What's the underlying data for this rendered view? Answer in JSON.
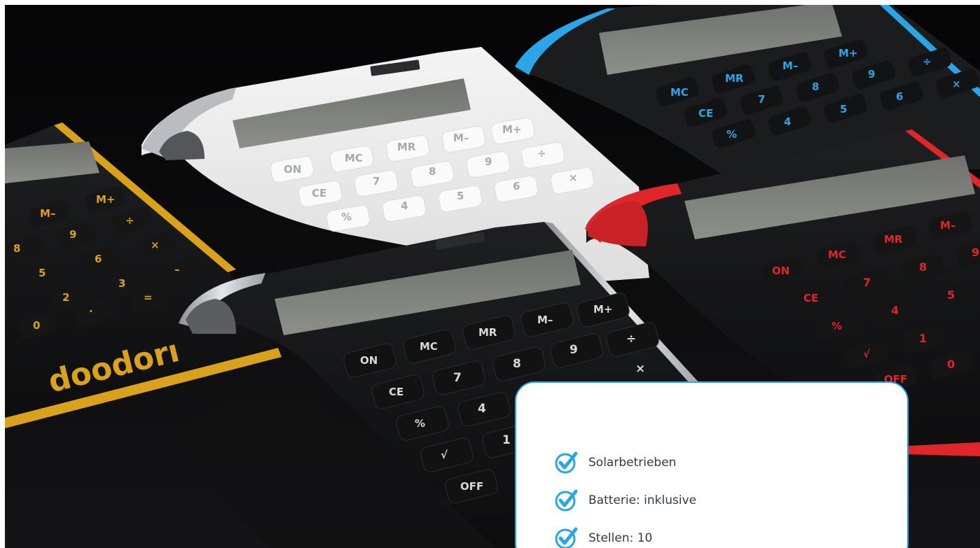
{
  "features": {
    "accent_color": "#2aa6e8",
    "icon": "checkmark-circle-icon",
    "items": [
      {
        "label": "Solarbetrieben"
      },
      {
        "label": "Batterie: inklusive"
      },
      {
        "label": "Stellen: 10"
      }
    ]
  },
  "photo": {
    "subject": "desk calculators",
    "colors": [
      "#d9a21a",
      "#e8e8e8",
      "#2aa6e8",
      "#e0262b",
      "#c9ccd0"
    ],
    "calculator_keys": {
      "memory_row": [
        "MC",
        "MR",
        "M–",
        "M+"
      ],
      "row1": [
        "CE",
        "7",
        "8",
        "9",
        "÷"
      ],
      "row2": [
        "%",
        "4",
        "5",
        "6",
        "×"
      ],
      "row3": [
        "√",
        "1",
        "2",
        "3",
        "–"
      ],
      "row4": [
        "OFF",
        "0",
        "·",
        "=",
        "+"
      ],
      "on_key": "ON/AC"
    }
  }
}
